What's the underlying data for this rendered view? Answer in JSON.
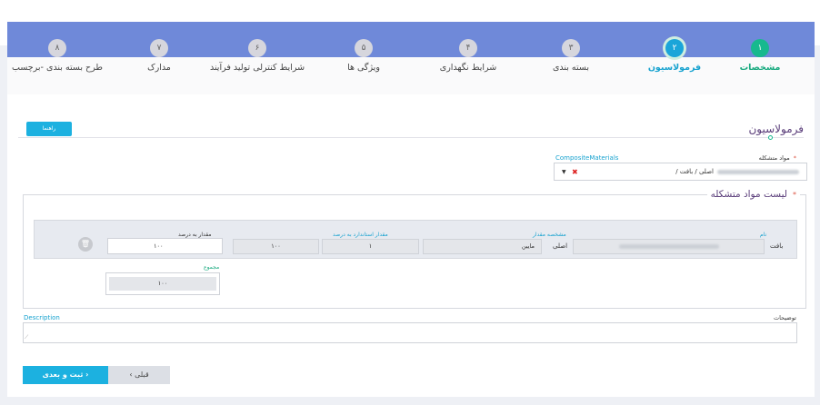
{
  "steps": [
    {
      "num": "۱",
      "label": "مشخصات",
      "state": "first"
    },
    {
      "num": "۲",
      "label": "فرمولاسیون",
      "state": "active"
    },
    {
      "num": "۳",
      "label": "بسته بندی",
      "state": "done"
    },
    {
      "num": "۴",
      "label": "شرایط نگهداری",
      "state": "done"
    },
    {
      "num": "۵",
      "label": "ویژگی ها",
      "state": "done"
    },
    {
      "num": "۶",
      "label": "شرایط کنترلی تولید فرآیند",
      "state": "done"
    },
    {
      "num": "۷",
      "label": "مدارک",
      "state": "done"
    },
    {
      "num": "۸",
      "label": "طرح بسته بندی -برچسب",
      "state": "done"
    }
  ],
  "form": {
    "help_label": "راهنما",
    "title": "فرمولاسیون",
    "materials_label": "مواد متشکله",
    "required_mark": "*",
    "composite_label": "CompositeMaterials",
    "materials_value": "/ اصلی / بافت",
    "list_title": "لیست مواد متشکله"
  },
  "table": {
    "headers": {
      "name": "نام",
      "quantity_spec": "مشخصه مقدار",
      "standard_percent": "مقدار استاندارد به درصد",
      "percent": "مقدار به درصد"
    },
    "row": {
      "texture": "بافت",
      "main": "اصلی",
      "quantity_spec_value": "مایین",
      "standard_low": "۱",
      "standard_high": "۱۰۰",
      "percent_value": "۱۰۰"
    }
  },
  "sum": {
    "label": "مجموع",
    "value": "۱۰۰"
  },
  "description": {
    "label_en": "Description",
    "label_fa": "توضیحات",
    "value": ""
  },
  "nav": {
    "next": "ثبت و بعدی ›",
    "prev": "‹ قبلی"
  }
}
